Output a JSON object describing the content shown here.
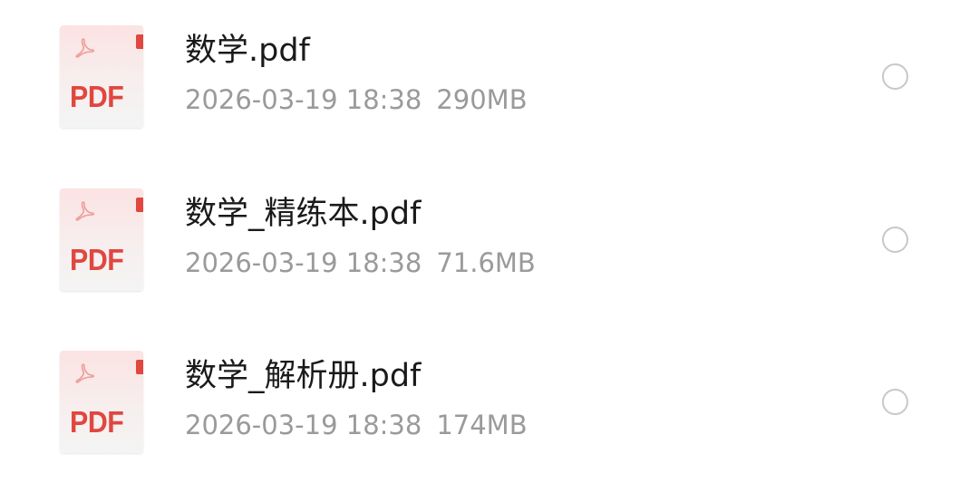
{
  "files": [
    {
      "name": "数学.pdf",
      "date": "2026-03-19 18:38",
      "size": "290MB",
      "icon": "pdf-file-icon",
      "icon_label": "PDF",
      "selected": false
    },
    {
      "name": "数学_精练本.pdf",
      "date": "2026-03-19 18:38",
      "size": "71.6MB",
      "icon": "pdf-file-icon",
      "icon_label": "PDF",
      "selected": false
    },
    {
      "name": "数学_解析册.pdf",
      "date": "2026-03-19 18:38",
      "size": "174MB",
      "icon": "pdf-file-icon",
      "icon_label": "PDF",
      "selected": false
    }
  ],
  "colors": {
    "pdf_accent": "#e0473f",
    "name_text": "#1a1a1a",
    "meta_text": "#9a9a9a",
    "radio_border": "#c8c8c8"
  }
}
